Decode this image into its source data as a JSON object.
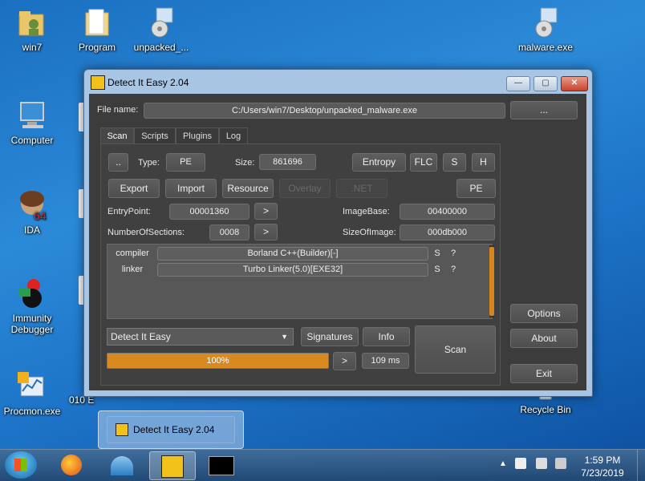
{
  "desktop": {
    "icons": [
      {
        "label": "win7"
      },
      {
        "label": "Program"
      },
      {
        "label": "unpacked_..."
      },
      {
        "label": "malware.exe"
      },
      {
        "label": "Computer"
      },
      {
        "label": "IDA"
      },
      {
        "label": "Immunity Debugger"
      },
      {
        "label": "Procmon.exe"
      },
      {
        "label": "010 E"
      },
      {
        "label": "Recycle Bin"
      }
    ]
  },
  "window": {
    "title": "Detect It Easy 2.04",
    "controls": {
      "minimize": "—",
      "maximize": "▢",
      "close": "✕"
    }
  },
  "file": {
    "label": "File name:",
    "value": "C:/Users/win7/Desktop/unpacked_malware.exe",
    "browse": "..."
  },
  "tabs": [
    "Scan",
    "Scripts",
    "Plugins",
    "Log"
  ],
  "scan": {
    "dotdot": "..",
    "type_label": "Type:",
    "type_value": "PE",
    "size_label": "Size:",
    "size_value": "861696",
    "entropy": "Entropy",
    "flc": "FLC",
    "s": "S",
    "h": "H",
    "export": "Export",
    "import": "Import",
    "resource": "Resource",
    "overlay": "Overlay",
    "net": ".NET",
    "pe": "PE",
    "entrypoint_label": "EntryPoint:",
    "entrypoint_value": "00001360",
    "imagebase_label": "ImageBase:",
    "imagebase_value": "00400000",
    "sections_label": "NumberOfSections:",
    "sections_value": "0008",
    "sizeofimage_label": "SizeOfImage:",
    "sizeofimage_value": "000db000",
    "arrow": ">",
    "results": [
      {
        "kind": "compiler",
        "value": "Borland C++(Builder)[-]",
        "s": "S",
        "q": "?"
      },
      {
        "kind": "linker",
        "value": "Turbo Linker(5.0)[EXE32]",
        "s": "S",
        "q": "?"
      }
    ],
    "engine": "Detect It Easy",
    "signatures": "Signatures",
    "info": "Info",
    "scan_button": "Scan",
    "progress": {
      "value": 100,
      "text": "100%"
    },
    "time": "109 ms"
  },
  "side_buttons": {
    "options": "Options",
    "about": "About",
    "exit": "Exit"
  },
  "taskbar": {
    "preview_title": "Detect It Easy 2.04",
    "time": "1:59 PM",
    "date": "7/23/2019"
  },
  "colors": {
    "accent": "#d88a20",
    "window_bg": "#3c3c3c"
  }
}
